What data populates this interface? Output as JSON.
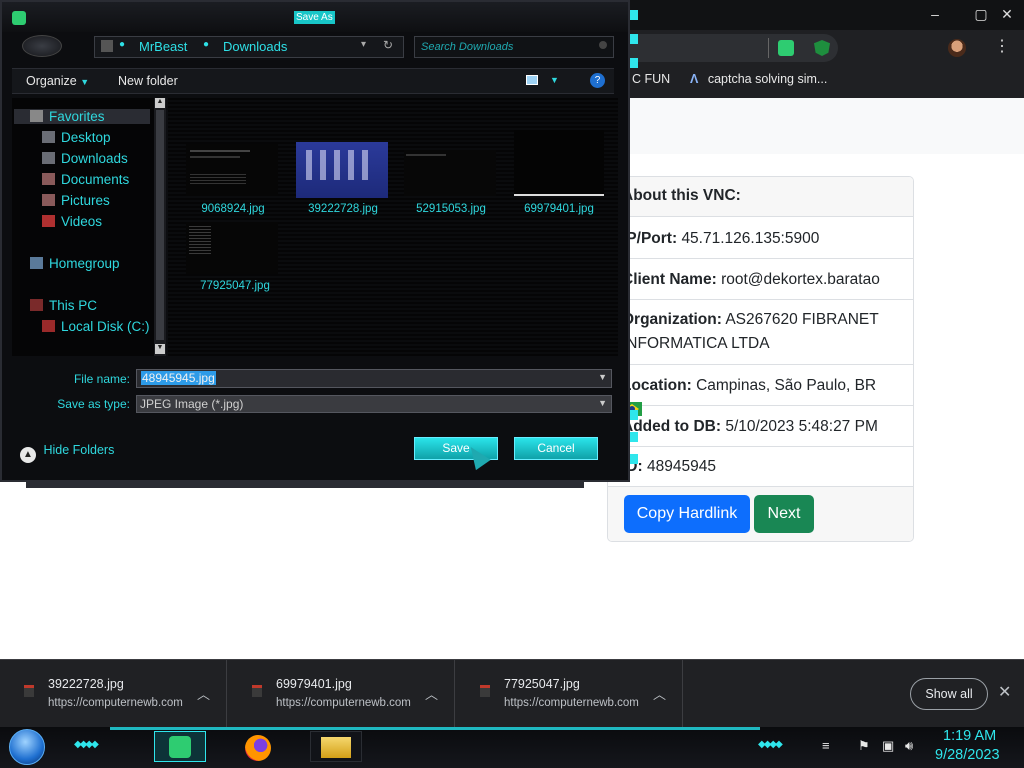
{
  "browser": {
    "bookmarks": [
      {
        "label": "C FUN"
      },
      {
        "label": "captcha solving sim..."
      }
    ]
  },
  "card": {
    "header": "About this VNC:",
    "rows": [
      {
        "label": "IP/Port:",
        "value": "45.71.126.135:5900"
      },
      {
        "label": "Client Name:",
        "value": "root@dekortex.baratao"
      },
      {
        "label": "Organization:",
        "value": "AS267620 FIBRANET INFORMATICA LTDA"
      },
      {
        "label": "Location:",
        "value": "Campinas, São Paulo, BR"
      },
      {
        "label": "Added to DB:",
        "value": "5/10/2023 5:48:27 PM"
      },
      {
        "label": "ID:",
        "value": "48945945"
      }
    ],
    "copy_button": "Copy Hardlink",
    "next_button": "Next",
    "colors": {
      "copy": "#0d6efd",
      "next": "#198754"
    }
  },
  "dialog": {
    "title": "Save As",
    "breadcrumb": [
      "MrBeast",
      "Downloads"
    ],
    "search_placeholder": "Search Downloads",
    "toolbar": {
      "organize": "Organize",
      "new_folder": "New folder"
    },
    "nav": {
      "favorites": "Favorites",
      "items": [
        "Desktop",
        "Downloads",
        "Documents",
        "Pictures",
        "Videos"
      ],
      "homegroup": "Homegroup",
      "this_pc": "This PC",
      "local_disk": "Local Disk (C:)"
    },
    "files": [
      "9068924.jpg",
      "39222728.jpg",
      "52915053.jpg",
      "69979401.jpg",
      "77925047.jpg"
    ],
    "file_name_label": "File name:",
    "file_name_value": "48945945.jpg",
    "save_type_label": "Save as type:",
    "save_type_value": "JPEG Image (*.jpg)",
    "save_button": "Save",
    "cancel_button": "Cancel",
    "hide_folders": "Hide Folders"
  },
  "downloads": {
    "items": [
      {
        "name": "39222728.jpg",
        "source": "https://computernewb.com"
      },
      {
        "name": "69979401.jpg",
        "source": "https://computernewb.com"
      },
      {
        "name": "77925047.jpg",
        "source": "https://computernewb.com"
      }
    ],
    "show_all": "Show all"
  },
  "taskbar": {
    "time": "1:19 AM",
    "date": "9/28/2023"
  },
  "icons": [
    "app-icon",
    "back-icon",
    "refresh-icon",
    "search-icon",
    "view-icon",
    "help-icon",
    "star-icon",
    "folder-icon",
    "computer-icon",
    "drive-icon",
    "file-icon",
    "chevron-up-icon",
    "close-icon",
    "firefox-icon",
    "explorer-icon",
    "flag-icon",
    "network-icon",
    "volume-icon"
  ]
}
